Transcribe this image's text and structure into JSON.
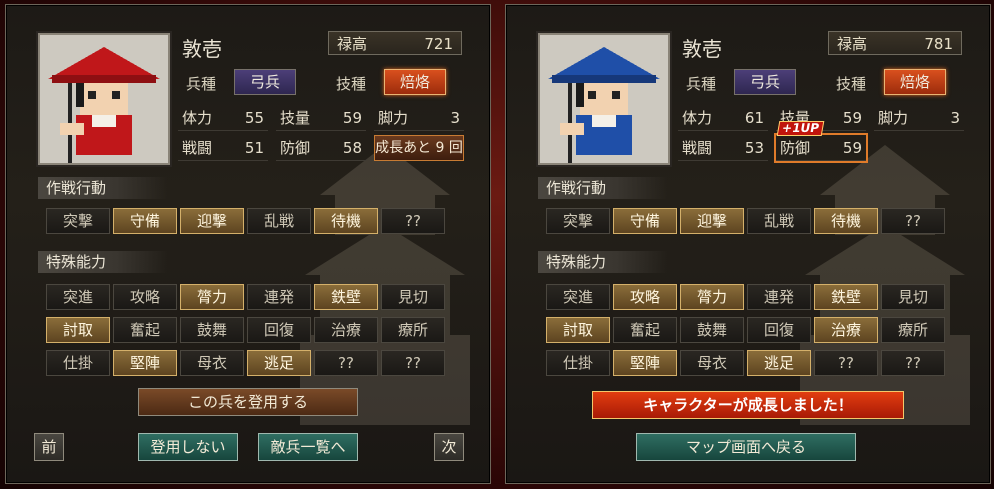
{
  "left": {
    "name": "敦壱",
    "stock_label": "禄高",
    "stock_value": "721",
    "unit_type_label": "兵種",
    "unit_type": "弓兵",
    "skill_label": "技種",
    "skill": "焙烙",
    "stats": {
      "hp_label": "体力",
      "hp": "55",
      "tech_label": "技量",
      "tech": "59",
      "leg_label": "脚力",
      "leg": "3",
      "atk_label": "戦闘",
      "atk": "51",
      "def_label": "防御",
      "def": "58"
    },
    "growth_text": "成長あと 9 回",
    "tactics_title": "作戦行動",
    "tactics": [
      {
        "label": "突撃",
        "on": false
      },
      {
        "label": "守備",
        "on": true
      },
      {
        "label": "迎撃",
        "on": true
      },
      {
        "label": "乱戦",
        "on": false
      },
      {
        "label": "待機",
        "on": true
      },
      {
        "label": "??",
        "on": false
      }
    ],
    "abilities_title": "特殊能力",
    "abilities": [
      {
        "label": "突進",
        "on": false
      },
      {
        "label": "攻略",
        "on": false
      },
      {
        "label": "膂力",
        "on": true
      },
      {
        "label": "連発",
        "on": false
      },
      {
        "label": "鉄壁",
        "on": true
      },
      {
        "label": "見切",
        "on": false
      },
      {
        "label": "討取",
        "on": true
      },
      {
        "label": "奮起",
        "on": false
      },
      {
        "label": "鼓舞",
        "on": false
      },
      {
        "label": "回復",
        "on": false
      },
      {
        "label": "治療",
        "on": false
      },
      {
        "label": "療所",
        "on": false
      },
      {
        "label": "仕掛",
        "on": false
      },
      {
        "label": "堅陣",
        "on": true
      },
      {
        "label": "母衣",
        "on": false
      },
      {
        "label": "逃足",
        "on": true
      },
      {
        "label": "??",
        "on": false
      },
      {
        "label": "??",
        "on": false
      }
    ],
    "recruit_button": "この兵を登用する",
    "prev_button": "前",
    "decline_button": "登用しない",
    "enemy_list_button": "敵兵一覧へ",
    "next_button": "次"
  },
  "right": {
    "name": "敦壱",
    "stock_label": "禄高",
    "stock_value": "781",
    "unit_type_label": "兵種",
    "unit_type": "弓兵",
    "skill_label": "技種",
    "skill": "焙烙",
    "stats": {
      "hp_label": "体力",
      "hp": "61",
      "tech_label": "技量",
      "tech": "59",
      "leg_label": "脚力",
      "leg": "3",
      "atk_label": "戦闘",
      "atk": "53",
      "def_label": "防御",
      "def": "59"
    },
    "levelup_badge": "+1UP",
    "tactics_title": "作戦行動",
    "tactics": [
      {
        "label": "突撃",
        "on": false
      },
      {
        "label": "守備",
        "on": true
      },
      {
        "label": "迎撃",
        "on": true
      },
      {
        "label": "乱戦",
        "on": false
      },
      {
        "label": "待機",
        "on": true
      },
      {
        "label": "??",
        "on": false
      }
    ],
    "abilities_title": "特殊能力",
    "abilities": [
      {
        "label": "突進",
        "on": false
      },
      {
        "label": "攻略",
        "on": true
      },
      {
        "label": "膂力",
        "on": true
      },
      {
        "label": "連発",
        "on": false
      },
      {
        "label": "鉄壁",
        "on": true
      },
      {
        "label": "見切",
        "on": false
      },
      {
        "label": "討取",
        "on": true
      },
      {
        "label": "奮起",
        "on": false
      },
      {
        "label": "鼓舞",
        "on": false
      },
      {
        "label": "回復",
        "on": false
      },
      {
        "label": "治療",
        "on": true
      },
      {
        "label": "療所",
        "on": false
      },
      {
        "label": "仕掛",
        "on": false
      },
      {
        "label": "堅陣",
        "on": true
      },
      {
        "label": "母衣",
        "on": false
      },
      {
        "label": "逃足",
        "on": true
      },
      {
        "label": "??",
        "on": false
      },
      {
        "label": "??",
        "on": false
      }
    ],
    "growth_banner": "キャラクターが成長しました！",
    "map_button": "マップ画面へ戻る"
  },
  "colors": {
    "hat_left": "#c0171a",
    "hat_right": "#1f4fa8",
    "accent_orange": "#e07b2a"
  }
}
